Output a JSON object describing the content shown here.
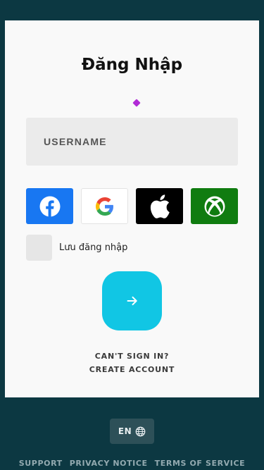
{
  "login": {
    "title": "Đăng Nhập",
    "username_placeholder": "USERNAME",
    "remember_label": "Lưu đăng nhập",
    "cant_sign_in": "CAN'T SIGN IN?",
    "create_account": "CREATE ACCOUNT",
    "social": [
      {
        "name": "facebook",
        "icon": "facebook-icon",
        "color": "#1877f2"
      },
      {
        "name": "google",
        "icon": "google-icon",
        "color": "#ffffff"
      },
      {
        "name": "apple",
        "icon": "apple-icon",
        "color": "#000000"
      },
      {
        "name": "xbox",
        "icon": "xbox-icon",
        "color": "#107c10"
      }
    ],
    "submit_icon": "arrow-right-icon",
    "accent_color": "#11c6e4"
  },
  "language": {
    "current": "EN",
    "icon": "globe-icon"
  },
  "footer": {
    "support": "SUPPORT",
    "privacy": "PRIVACY NOTICE",
    "terms": "TERMS OF SERVICE"
  },
  "colors": {
    "background": "#0c3842",
    "card": "#f9f9f9"
  }
}
